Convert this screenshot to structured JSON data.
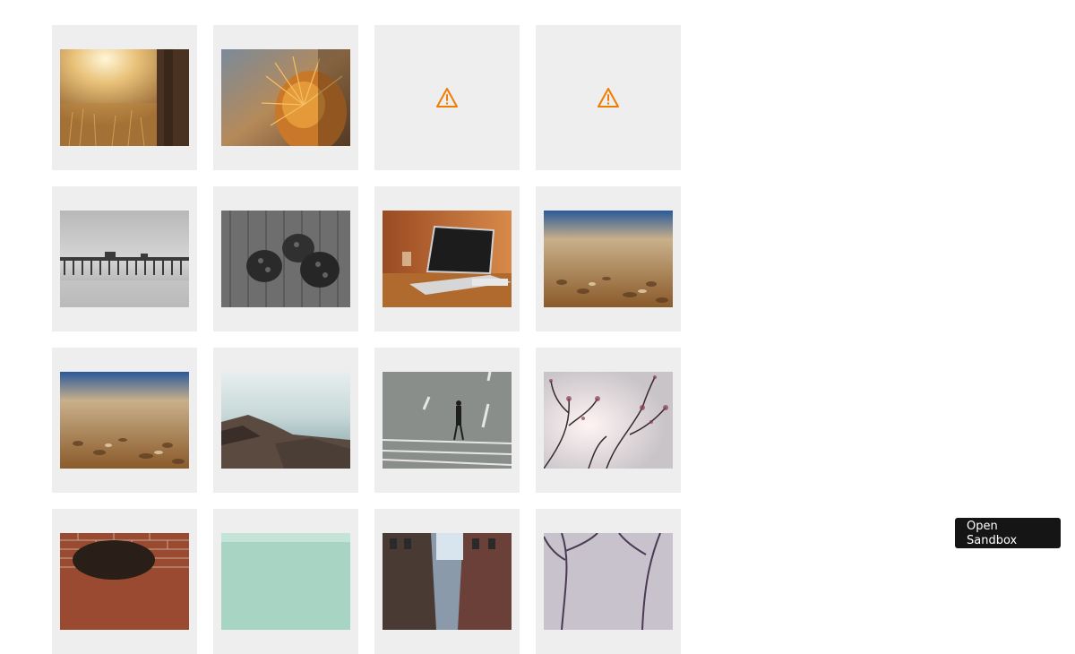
{
  "gallery": {
    "tiles": [
      {
        "kind": "image",
        "subject": "sunlit-grass"
      },
      {
        "kind": "image",
        "subject": "cactus-spines"
      },
      {
        "kind": "error",
        "icon": "warning-icon",
        "color": "#f07c00"
      },
      {
        "kind": "error",
        "icon": "warning-icon",
        "color": "#f07c00"
      },
      {
        "kind": "image",
        "subject": "pier-bw"
      },
      {
        "kind": "image",
        "subject": "pinecones-bw"
      },
      {
        "kind": "image",
        "subject": "laptop-desk"
      },
      {
        "kind": "image",
        "subject": "beach-pebbles"
      },
      {
        "kind": "image",
        "subject": "beach-pebbles"
      },
      {
        "kind": "image",
        "subject": "rocky-shore"
      },
      {
        "kind": "image",
        "subject": "man-walking-street"
      },
      {
        "kind": "image",
        "subject": "tree-branches"
      },
      {
        "kind": "image",
        "subject": "brick-wall"
      },
      {
        "kind": "image",
        "subject": "teal-sky"
      },
      {
        "kind": "image",
        "subject": "city-street"
      },
      {
        "kind": "image",
        "subject": "bare-trees"
      }
    ]
  },
  "sandbox_button": {
    "label": "Open Sandbox"
  },
  "colors": {
    "tile_background": "#eeeeee",
    "warning": "#f07c00",
    "button_background": "#151515",
    "button_text": "#ffffff"
  }
}
